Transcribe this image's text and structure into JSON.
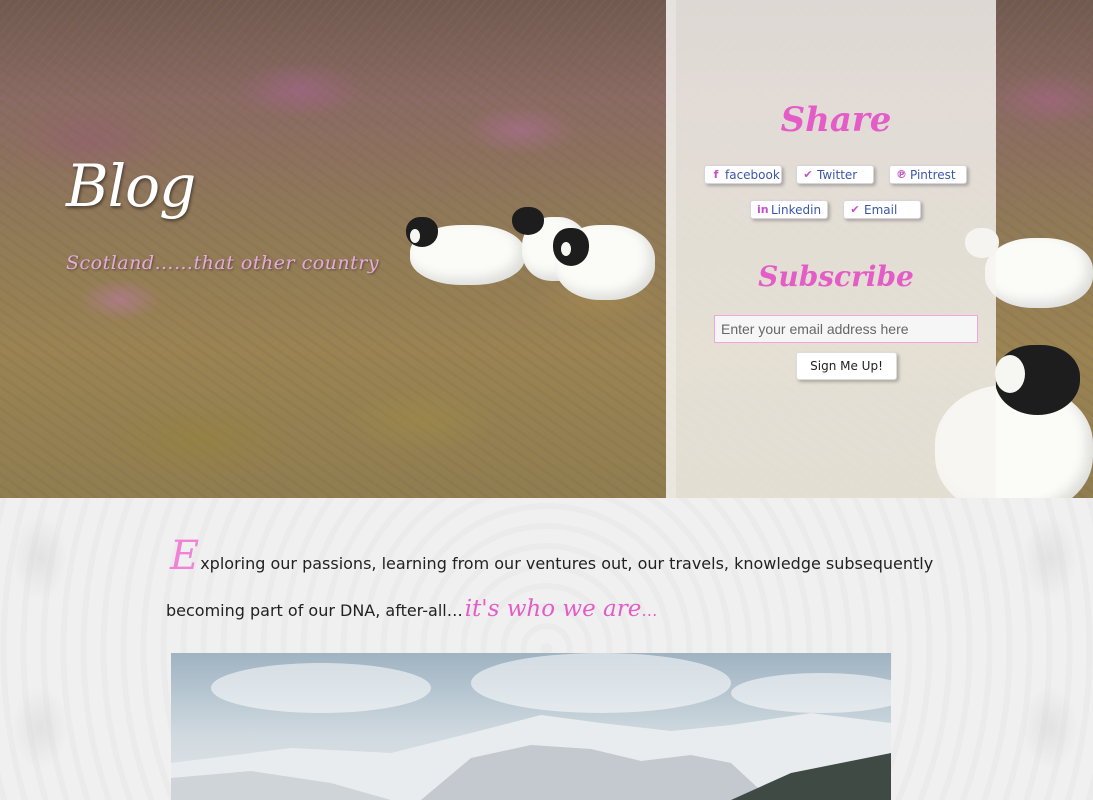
{
  "hero": {
    "title": "Blog",
    "subtitle": "Scotland……that other country"
  },
  "sidebar": {
    "share_heading": "Share",
    "share_buttons": [
      {
        "label": "facebook",
        "icon": "facebook-icon"
      },
      {
        "label": "Twitter",
        "icon": "twitter-icon"
      },
      {
        "label": "Pintrest",
        "icon": "pinterest-icon"
      },
      {
        "label": "Linkedin",
        "icon": "linkedin-icon"
      },
      {
        "label": "Email",
        "icon": "email-icon"
      }
    ],
    "subscribe_heading": "Subscribe",
    "email_placeholder": "Enter your email address here",
    "signup_label": "Sign Me Up!"
  },
  "content": {
    "dropcap": "E",
    "intro_line1": "xploring our passions, learning from our ventures out, our travels, knowledge subsequently",
    "intro_line2": "becoming part of our DNA, after-all…",
    "tagline": "it's who we are",
    "tagline_end": "…"
  },
  "colors": {
    "accent_pink": "#e45cc8",
    "link_blue": "#3a58a7"
  }
}
